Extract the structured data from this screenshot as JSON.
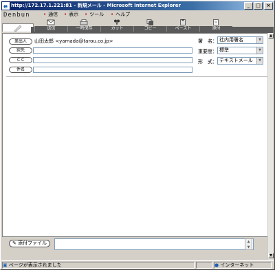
{
  "window": {
    "title": "http://172.17.1.221:81 - 新規メール - Microsoft Internet Explorer",
    "minimize": "_",
    "maximize": "□",
    "close": "×"
  },
  "app": {
    "logo": "Denbun"
  },
  "menu": [
    {
      "label": "通信"
    },
    {
      "label": "表示"
    },
    {
      "label": "ツール"
    },
    {
      "label": "ヘルプ"
    }
  ],
  "toolbar": [
    {
      "label": "送信",
      "icon": "envelope-icon"
    },
    {
      "label": "一時保存",
      "icon": "printer-icon"
    },
    {
      "label": "カット",
      "icon": "scissors-icon"
    },
    {
      "label": "コピー",
      "icon": "copy-icon"
    },
    {
      "label": "ペースト",
      "icon": "paste-icon"
    },
    {
      "label": "添付",
      "icon": "attach-icon"
    }
  ],
  "header_fields": {
    "from_button": "差出人",
    "from_value": "山田太郎 <yamada@tarou.co.jp>",
    "to_button": "宛先",
    "cc_button": "ＣＣ",
    "subject_button": "件名"
  },
  "options": {
    "signature_label": "署　名：",
    "signature_value": "社内用署名",
    "priority_label": "重要度：",
    "priority_value": "標準",
    "format_label": "形　式：",
    "format_value": "テキストメール"
  },
  "attachment": {
    "button": "添付ファイル"
  },
  "status": {
    "text": "ページが表示されました",
    "zone": "インターネット"
  }
}
